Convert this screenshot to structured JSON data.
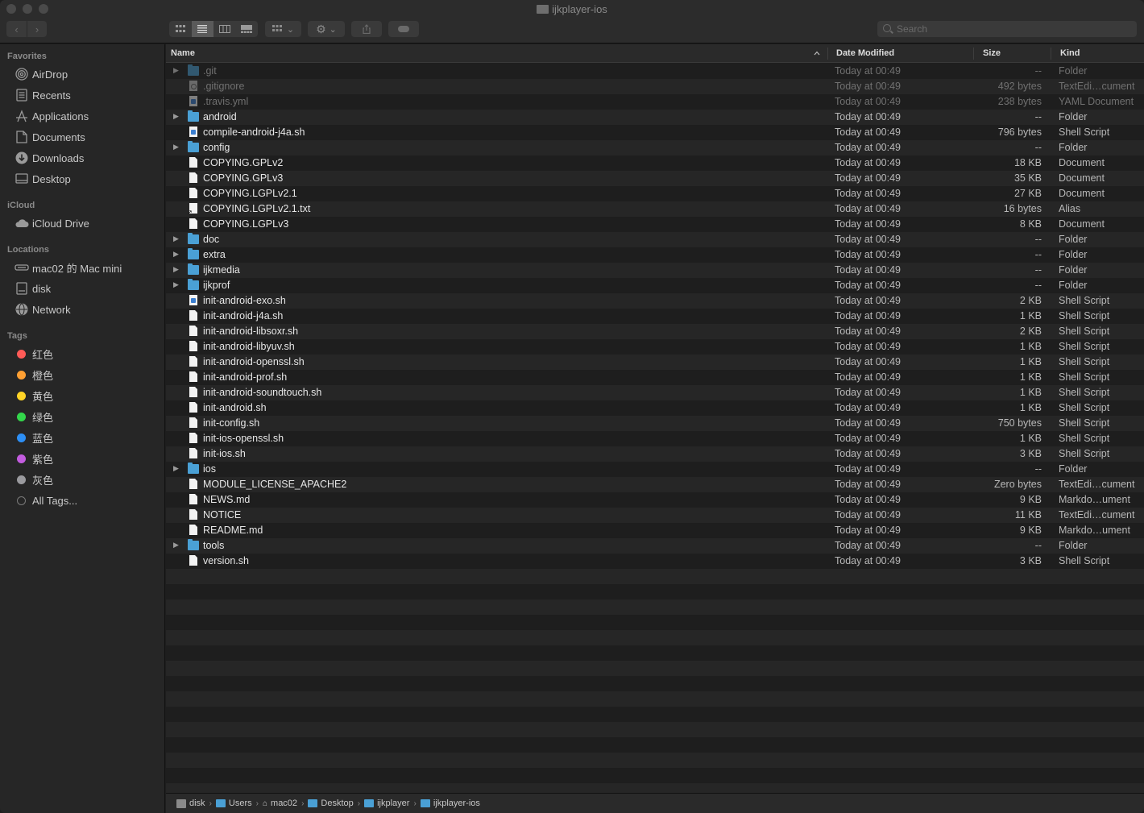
{
  "window": {
    "title": "ijkplayer-ios"
  },
  "toolbar": {
    "back": "‹",
    "forward": "›",
    "views": [
      "icon-view",
      "list-view",
      "column-view",
      "gallery-view"
    ],
    "search_placeholder": "Search"
  },
  "sidebar": {
    "favorites_title": "Favorites",
    "favorites": [
      {
        "label": "AirDrop",
        "icon": "airdrop-icon"
      },
      {
        "label": "Recents",
        "icon": "recents-icon"
      },
      {
        "label": "Applications",
        "icon": "applications-icon"
      },
      {
        "label": "Documents",
        "icon": "documents-icon"
      },
      {
        "label": "Downloads",
        "icon": "downloads-icon"
      },
      {
        "label": "Desktop",
        "icon": "desktop-icon"
      }
    ],
    "icloud_title": "iCloud",
    "icloud": [
      {
        "label": "iCloud Drive",
        "icon": "cloud-icon"
      }
    ],
    "locations_title": "Locations",
    "locations": [
      {
        "label": "mac02 的 Mac mini",
        "icon": "computer-icon"
      },
      {
        "label": "disk",
        "icon": "disk-icon"
      },
      {
        "label": "Network",
        "icon": "network-icon"
      }
    ],
    "tags_title": "Tags",
    "tags": [
      {
        "label": "红色",
        "color": "#ff5b57"
      },
      {
        "label": "橙色",
        "color": "#ffa033"
      },
      {
        "label": "黄色",
        "color": "#ffd426"
      },
      {
        "label": "绿色",
        "color": "#33d74b"
      },
      {
        "label": "蓝色",
        "color": "#2d8ff5"
      },
      {
        "label": "紫色",
        "color": "#c35cdf"
      },
      {
        "label": "灰色",
        "color": "#9a9a9e"
      }
    ],
    "all_tags": "All Tags..."
  },
  "columns": {
    "name": "Name",
    "date": "Date Modified",
    "size": "Size",
    "kind": "Kind"
  },
  "files": [
    {
      "name": ".git",
      "date": "Today at 00:49",
      "size": "--",
      "kind": "Folder",
      "type": "folder",
      "hidden": true
    },
    {
      "name": ".gitignore",
      "date": "Today at 00:49",
      "size": "492 bytes",
      "kind": "TextEdi…cument",
      "type": "gear",
      "hidden": true
    },
    {
      "name": ".travis.yml",
      "date": "Today at 00:49",
      "size": "238 bytes",
      "kind": "YAML Document",
      "type": "script",
      "hidden": true
    },
    {
      "name": "android",
      "date": "Today at 00:49",
      "size": "--",
      "kind": "Folder",
      "type": "folder"
    },
    {
      "name": "compile-android-j4a.sh",
      "date": "Today at 00:49",
      "size": "796 bytes",
      "kind": "Shell Script",
      "type": "script"
    },
    {
      "name": "config",
      "date": "Today at 00:49",
      "size": "--",
      "kind": "Folder",
      "type": "folder"
    },
    {
      "name": "COPYING.GPLv2",
      "date": "Today at 00:49",
      "size": "18 KB",
      "kind": "Document",
      "type": "doc"
    },
    {
      "name": "COPYING.GPLv3",
      "date": "Today at 00:49",
      "size": "35 KB",
      "kind": "Document",
      "type": "doc"
    },
    {
      "name": "COPYING.LGPLv2.1",
      "date": "Today at 00:49",
      "size": "27 KB",
      "kind": "Document",
      "type": "doc"
    },
    {
      "name": "COPYING.LGPLv2.1.txt",
      "date": "Today at 00:49",
      "size": "16 bytes",
      "kind": "Alias",
      "type": "alias"
    },
    {
      "name": "COPYING.LGPLv3",
      "date": "Today at 00:49",
      "size": "8 KB",
      "kind": "Document",
      "type": "doc"
    },
    {
      "name": "doc",
      "date": "Today at 00:49",
      "size": "--",
      "kind": "Folder",
      "type": "folder"
    },
    {
      "name": "extra",
      "date": "Today at 00:49",
      "size": "--",
      "kind": "Folder",
      "type": "folder"
    },
    {
      "name": "ijkmedia",
      "date": "Today at 00:49",
      "size": "--",
      "kind": "Folder",
      "type": "folder"
    },
    {
      "name": "ijkprof",
      "date": "Today at 00:49",
      "size": "--",
      "kind": "Folder",
      "type": "folder"
    },
    {
      "name": "init-android-exo.sh",
      "date": "Today at 00:49",
      "size": "2 KB",
      "kind": "Shell Script",
      "type": "script"
    },
    {
      "name": "init-android-j4a.sh",
      "date": "Today at 00:49",
      "size": "1 KB",
      "kind": "Shell Script",
      "type": "doc"
    },
    {
      "name": "init-android-libsoxr.sh",
      "date": "Today at 00:49",
      "size": "2 KB",
      "kind": "Shell Script",
      "type": "doc"
    },
    {
      "name": "init-android-libyuv.sh",
      "date": "Today at 00:49",
      "size": "1 KB",
      "kind": "Shell Script",
      "type": "doc"
    },
    {
      "name": "init-android-openssl.sh",
      "date": "Today at 00:49",
      "size": "1 KB",
      "kind": "Shell Script",
      "type": "doc"
    },
    {
      "name": "init-android-prof.sh",
      "date": "Today at 00:49",
      "size": "1 KB",
      "kind": "Shell Script",
      "type": "doc"
    },
    {
      "name": "init-android-soundtouch.sh",
      "date": "Today at 00:49",
      "size": "1 KB",
      "kind": "Shell Script",
      "type": "doc"
    },
    {
      "name": "init-android.sh",
      "date": "Today at 00:49",
      "size": "1 KB",
      "kind": "Shell Script",
      "type": "doc"
    },
    {
      "name": "init-config.sh",
      "date": "Today at 00:49",
      "size": "750 bytes",
      "kind": "Shell Script",
      "type": "doc"
    },
    {
      "name": "init-ios-openssl.sh",
      "date": "Today at 00:49",
      "size": "1 KB",
      "kind": "Shell Script",
      "type": "doc"
    },
    {
      "name": "init-ios.sh",
      "date": "Today at 00:49",
      "size": "3 KB",
      "kind": "Shell Script",
      "type": "doc"
    },
    {
      "name": "ios",
      "date": "Today at 00:49",
      "size": "--",
      "kind": "Folder",
      "type": "folder"
    },
    {
      "name": "MODULE_LICENSE_APACHE2",
      "date": "Today at 00:49",
      "size": "Zero bytes",
      "kind": "TextEdi…cument",
      "type": "doc"
    },
    {
      "name": "NEWS.md",
      "date": "Today at 00:49",
      "size": "9 KB",
      "kind": "Markdo…ument",
      "type": "doc"
    },
    {
      "name": "NOTICE",
      "date": "Today at 00:49",
      "size": "11 KB",
      "kind": "TextEdi…cument",
      "type": "doc"
    },
    {
      "name": "README.md",
      "date": "Today at 00:49",
      "size": "9 KB",
      "kind": "Markdo…ument",
      "type": "doc"
    },
    {
      "name": "tools",
      "date": "Today at 00:49",
      "size": "--",
      "kind": "Folder",
      "type": "folder"
    },
    {
      "name": "version.sh",
      "date": "Today at 00:49",
      "size": "3 KB",
      "kind": "Shell Script",
      "type": "doc"
    }
  ],
  "pathbar": [
    {
      "label": "disk",
      "icon": "disk-icon"
    },
    {
      "label": "Users",
      "icon": "folder-icon"
    },
    {
      "label": "mac02",
      "icon": "home-icon"
    },
    {
      "label": "Desktop",
      "icon": "folder-icon"
    },
    {
      "label": "ijkplayer",
      "icon": "folder-icon"
    },
    {
      "label": "ijkplayer-ios",
      "icon": "folder-icon"
    }
  ]
}
